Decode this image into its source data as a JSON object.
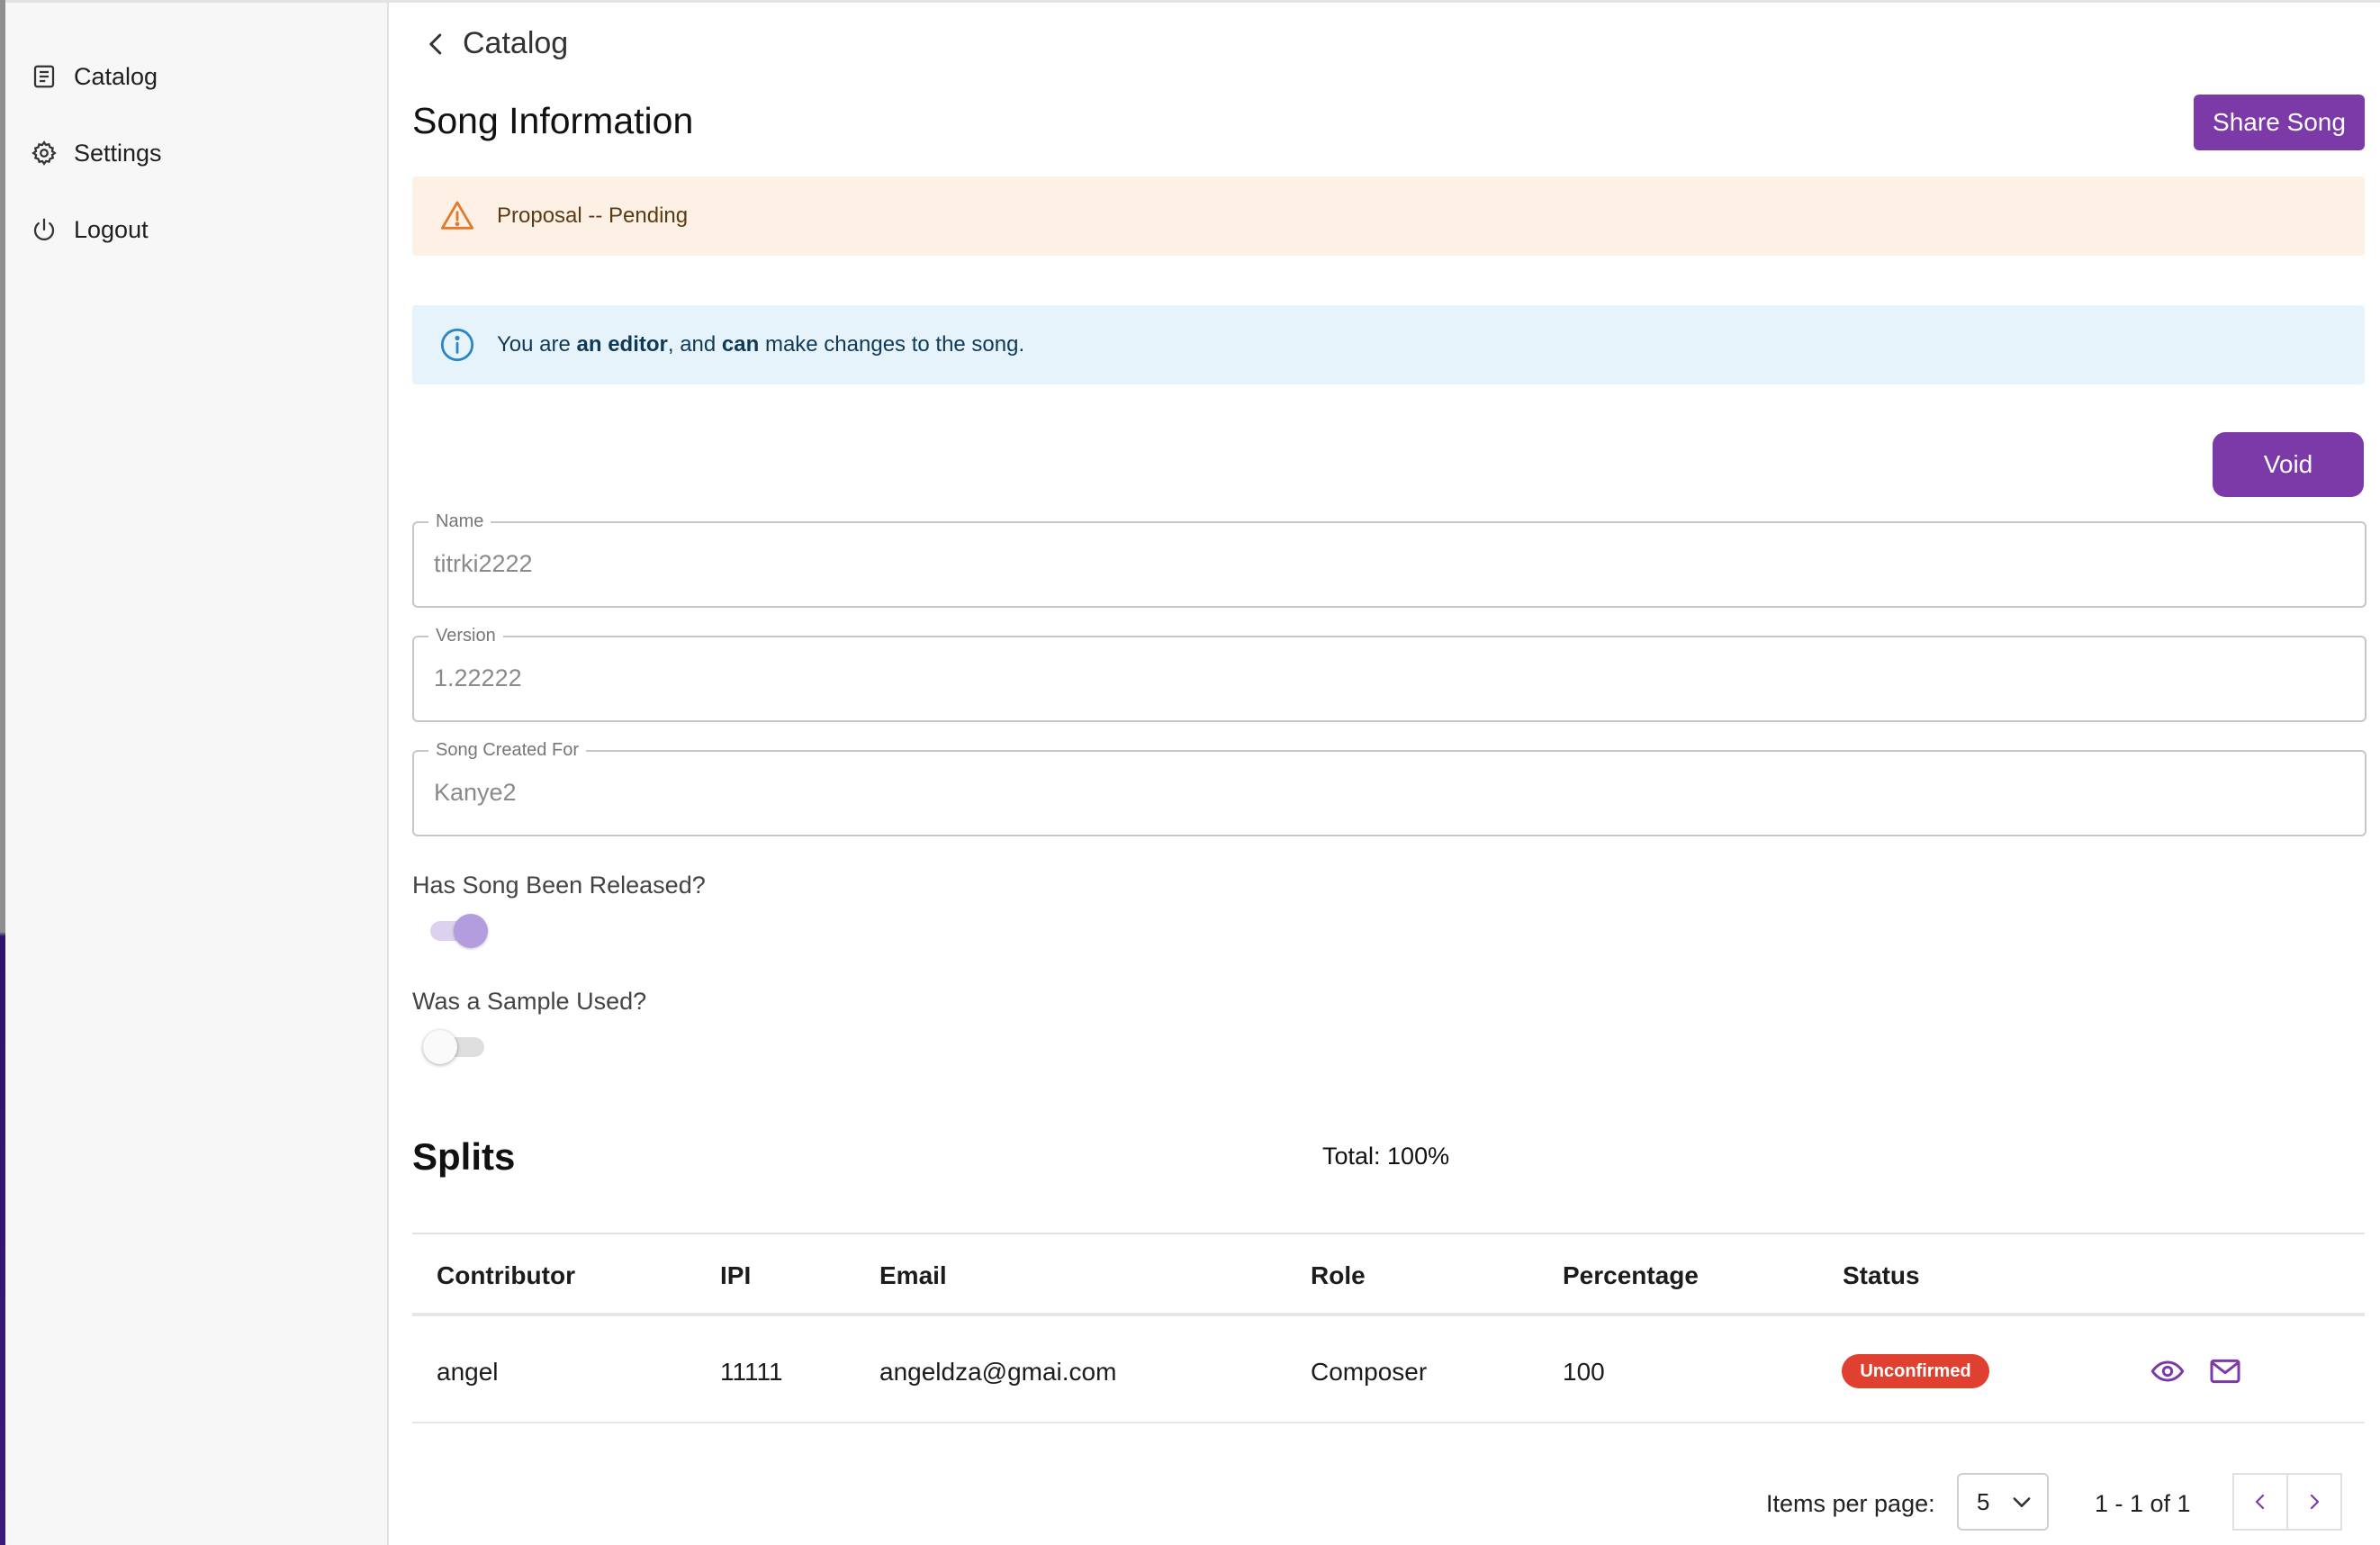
{
  "sidebar": {
    "items": [
      {
        "label": "Catalog",
        "icon": "catalog-icon"
      },
      {
        "label": "Settings",
        "icon": "gear-icon"
      },
      {
        "label": "Logout",
        "icon": "power-icon"
      }
    ]
  },
  "header": {
    "back_label": "Catalog",
    "title": "Song Information",
    "share_label": "Share Song"
  },
  "alerts": {
    "warning_text": "Proposal -- Pending",
    "info_prefix": "You are ",
    "info_role": "an editor",
    "info_mid": ", and ",
    "info_can": "can",
    "info_suffix": " make changes to the song."
  },
  "void_label": "Void",
  "form": {
    "name_label": "Name",
    "name_value": "titrki2222",
    "version_label": "Version",
    "version_value": "1.22222",
    "created_for_label": "Song Created For",
    "created_for_value": "Kanye2",
    "released_question": "Has Song Been Released?",
    "released_on": true,
    "sample_question": "Was a Sample Used?",
    "sample_on": false
  },
  "splits": {
    "title": "Splits",
    "total": "Total: 100%",
    "columns": [
      "Contributor",
      "IPI",
      "Email",
      "Role",
      "Percentage",
      "Status"
    ],
    "rows": [
      {
        "contributor": "angel",
        "ipi": "11111",
        "email": "angeldza@gmai.com",
        "role": "Composer",
        "percentage": "100",
        "status": "Unconfirmed"
      }
    ]
  },
  "pagination": {
    "items_label": "Items per page:",
    "per_page": "5",
    "range": "1 - 1 of 1"
  },
  "colors": {
    "accent": "#7b3aa8",
    "warning_bg": "#fdf1e5",
    "info_bg": "#e7f3fb",
    "badge_red": "#e0402f"
  }
}
